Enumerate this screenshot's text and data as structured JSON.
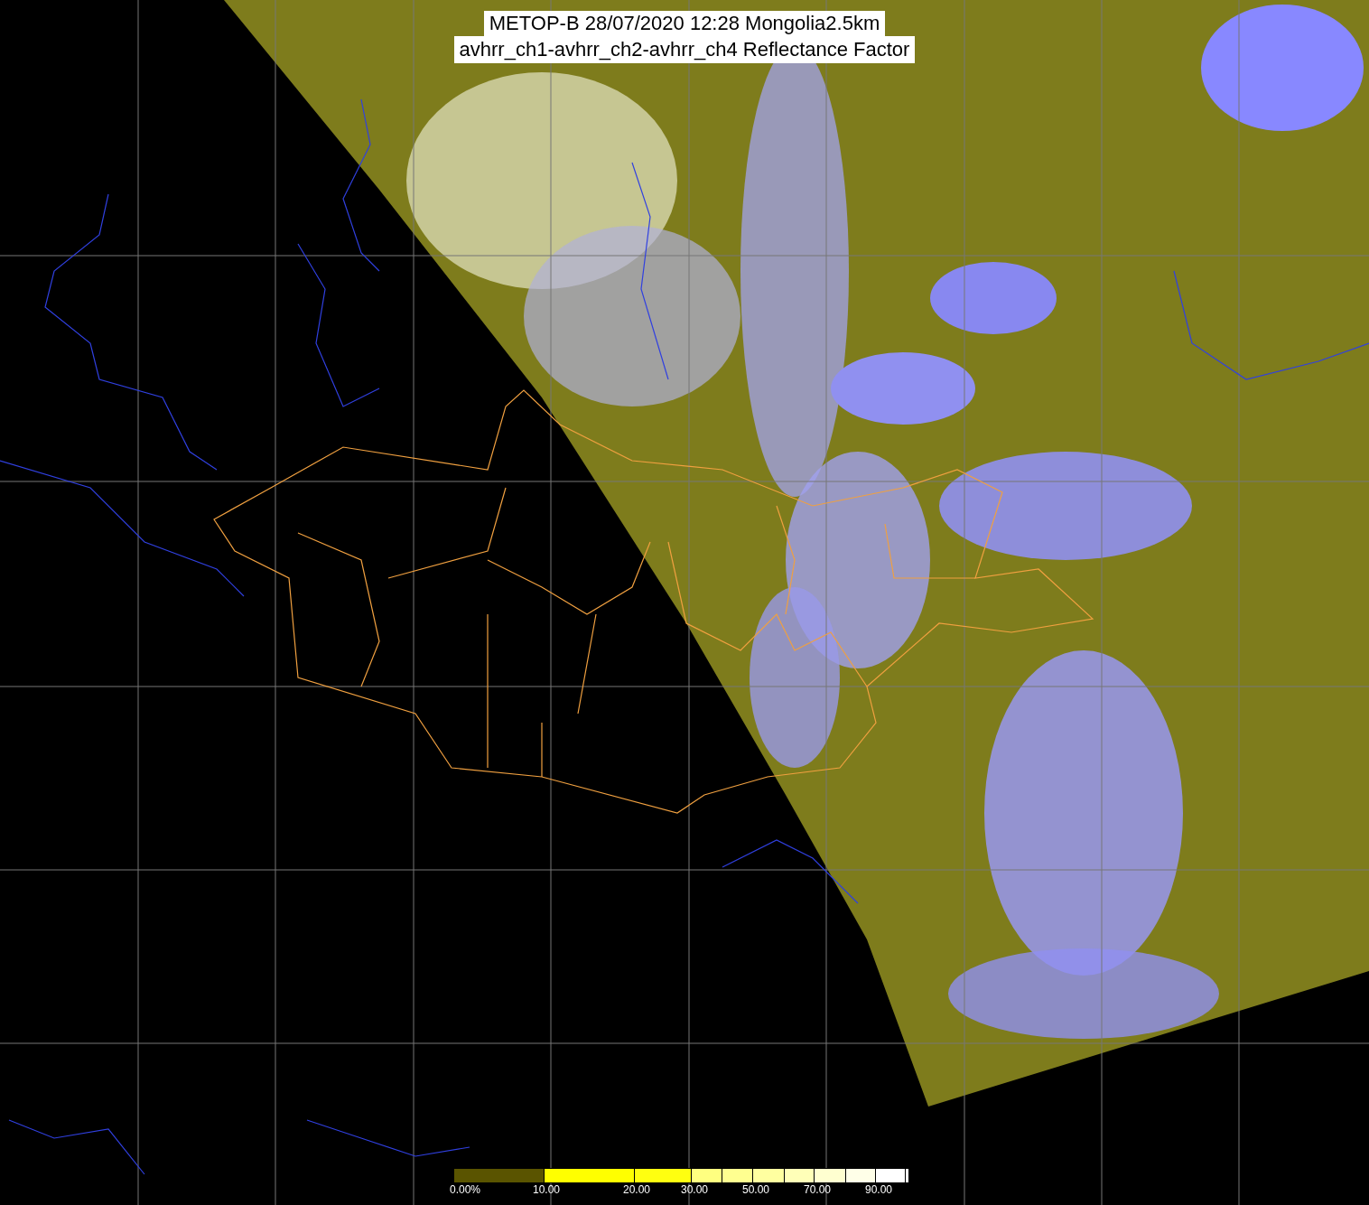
{
  "title": {
    "line_1": "METOP-B 28/07/2020 12:28 Mongolia2.5km",
    "line_2": "avhrr_ch1-avhrr_ch2-avhrr_ch4 Reflectance Factor"
  },
  "colorbar": {
    "segments": [
      {
        "color": "#5a5400",
        "label": "0.00%"
      },
      {
        "color": "#ffff00",
        "label": "10.00"
      },
      {
        "color": "#ffff10",
        "label": "20.00"
      },
      {
        "color": "#ffff80",
        "label": "30.00"
      },
      {
        "color": "#ffff90"
      },
      {
        "color": "#ffffa0",
        "label": "50.00"
      },
      {
        "color": "#ffffb8"
      },
      {
        "color": "#ffffd0",
        "label": "70.00"
      },
      {
        "color": "#ffffe8"
      },
      {
        "color": "#ffffff",
        "label": "90.00"
      },
      {
        "color": "#ffffff"
      }
    ]
  }
}
